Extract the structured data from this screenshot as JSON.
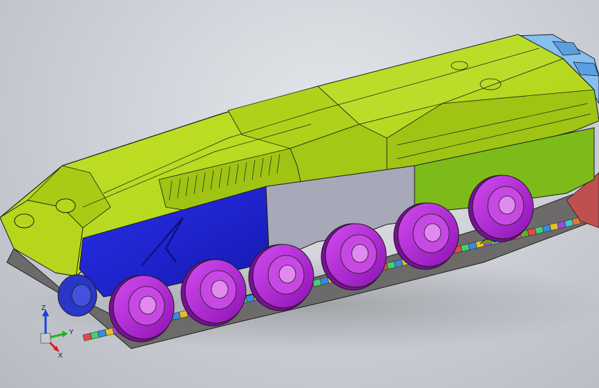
{
  "viewport": {
    "background": "#cfd2d8",
    "model": "tracked-vehicle-hull-assembly"
  },
  "colors": {
    "hull_top": "#b8dc1c",
    "hull_top_dark": "#97b814",
    "side_skirt_front": "#1f24d8",
    "side_skirt_mid": "#a7a9b8",
    "side_skirt_rear": "#7cbb1a",
    "roadwheel": "#b11fd6",
    "roadwheel_hub": "#d56be8",
    "idler": "#2a36c8",
    "rear_assembly": "#7fb8ee",
    "outline": "#1b1b1b"
  },
  "triad": {
    "x_label": "X",
    "y_label": "Y",
    "z_label": "Z",
    "x_color": "#e01818",
    "y_color": "#18b818",
    "z_color": "#1840e0"
  }
}
